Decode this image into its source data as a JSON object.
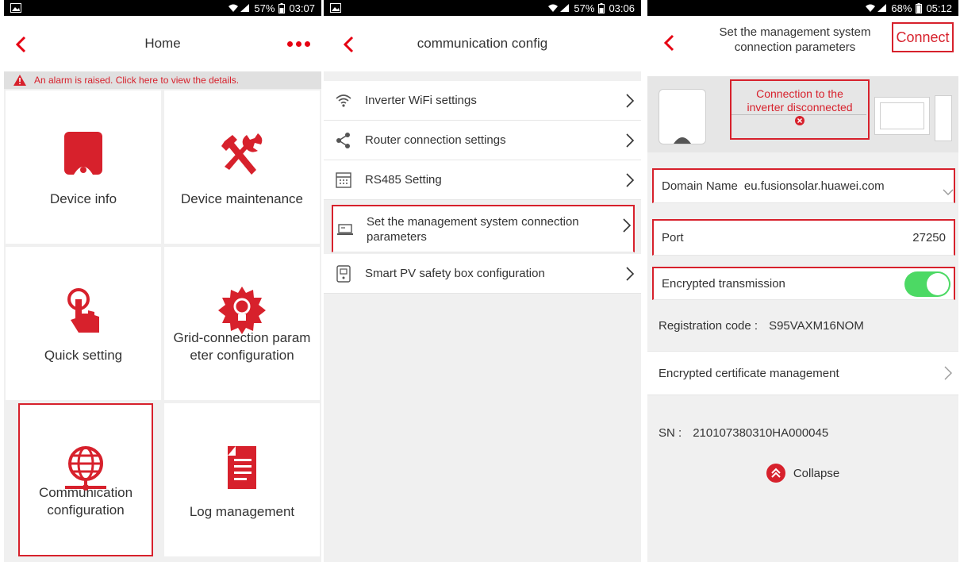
{
  "panel1": {
    "status": {
      "time": "03:07",
      "battery": "57%"
    },
    "title": "Home",
    "alarm": "An alarm is raised. Click here to view the details.",
    "tiles": [
      {
        "label": "Device info",
        "icon": "inverter-icon"
      },
      {
        "label": "Device maintenance",
        "icon": "tools-icon"
      },
      {
        "label": "Quick setting",
        "icon": "touch-hand-icon"
      },
      {
        "label": "Grid-connection param eter configuration",
        "icon": "bulb-gear-icon"
      },
      {
        "label": "Communication configuration",
        "icon": "globe-network-icon"
      },
      {
        "label": "Log management",
        "icon": "log-document-icon"
      }
    ]
  },
  "panel2": {
    "status": {
      "time": "03:06",
      "battery": "57%"
    },
    "title": "communication config",
    "items": [
      {
        "label": "Inverter WiFi settings",
        "icon": "wifi-icon"
      },
      {
        "label": "Router connection settings",
        "icon": "share-icon"
      },
      {
        "label": "RS485 Setting",
        "icon": "rs485-icon"
      },
      {
        "label": "Set the management system connection parameters",
        "icon": "laptop-icon"
      },
      {
        "label": "Smart PV safety box configuration",
        "icon": "safety-box-icon"
      }
    ]
  },
  "panel3": {
    "status": {
      "time": "05:12",
      "battery": "68%"
    },
    "title": "Set the management system connection parameters",
    "connect_label": "Connect",
    "disconnect_msg": "Connection to the inverter disconnected",
    "domain_label": "Domain Name",
    "domain_value": "eu.fusionsolar.huawei.com",
    "port_label": "Port",
    "port_value": "27250",
    "encrypted_label": "Encrypted transmission",
    "encrypted_on": true,
    "reg_label": "Registration code :",
    "reg_value": "S95VAXM16NOM",
    "cert_label": "Encrypted certificate management",
    "sn_label": "SN :",
    "sn_value": "210107380310HA000045",
    "collapse_label": "Collapse"
  },
  "colors": {
    "accent": "#e60012",
    "highlight": "#d7212c",
    "toggle": "#4cd964"
  }
}
